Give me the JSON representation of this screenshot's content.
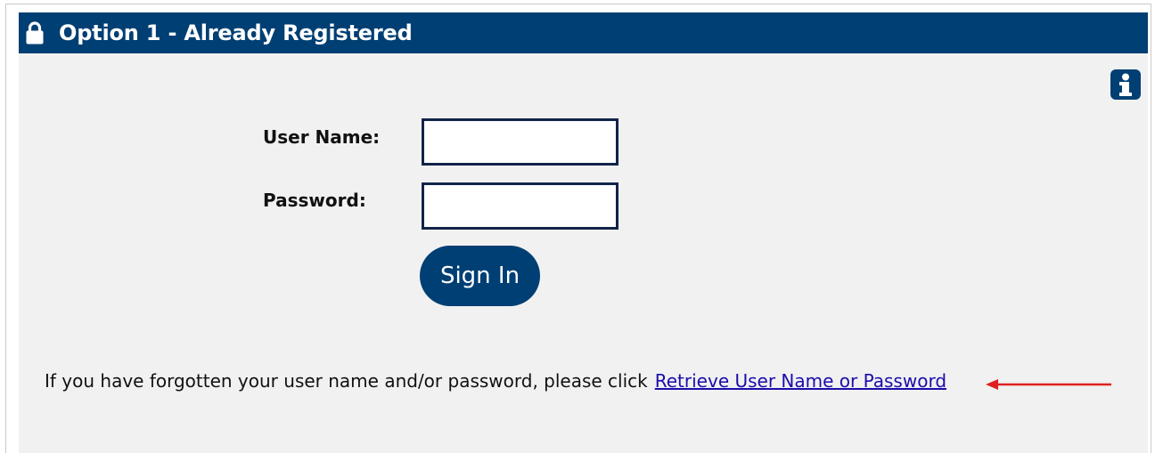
{
  "header": {
    "title": "Option 1 - Already Registered",
    "icon": "lock-icon",
    "background_color": "#003f73"
  },
  "info_button": {
    "icon": "info-icon"
  },
  "form": {
    "username_label": "User Name:",
    "username_value": "",
    "password_label": "Password:",
    "password_value": "",
    "signin_label": "Sign In"
  },
  "help": {
    "text": "If you have forgotten your user name and/or password, please click",
    "link_label": "Retrieve User Name or Password",
    "annotation_arrow_color": "#e02020"
  }
}
